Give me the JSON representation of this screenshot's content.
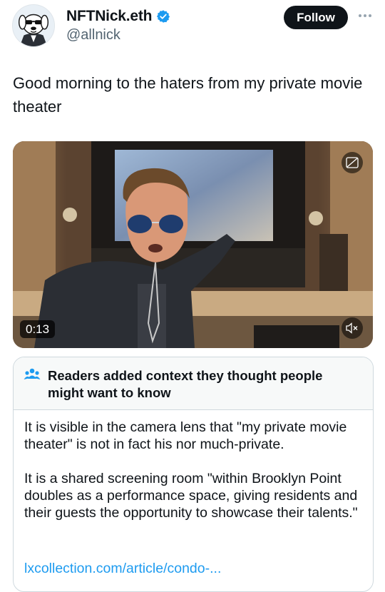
{
  "author": {
    "display_name": "NFTNick.eth",
    "handle": "@allnick",
    "avatar_icon": "dog-cartoon-avatar",
    "verified_icon": "verified-badge-icon",
    "verified_color": "#1d9bf0"
  },
  "actions": {
    "follow_label": "Follow",
    "more_icon": "more-options-icon"
  },
  "tweet": {
    "text": "Good morning to the haters from my private movie theater"
  },
  "media": {
    "type": "video",
    "duration_label": "0:13",
    "gif_icon": "gif-badge-icon",
    "mute_icon": "muted-speaker-icon"
  },
  "community_note": {
    "icon": "readers-people-icon",
    "title": "Readers added context they thought people might want to know",
    "paragraphs": [
      "It is visible in the camera lens that \"my private movie theater\" is not in fact his nor much-private.",
      "It is a shared screening room  \"within Brooklyn Point doubles as a performance space, giving residents and their guests the opportunity to showcase their talents.\""
    ],
    "link_text": "lxcollection.com/article/condo-...",
    "link_color": "#1d9bf0"
  }
}
